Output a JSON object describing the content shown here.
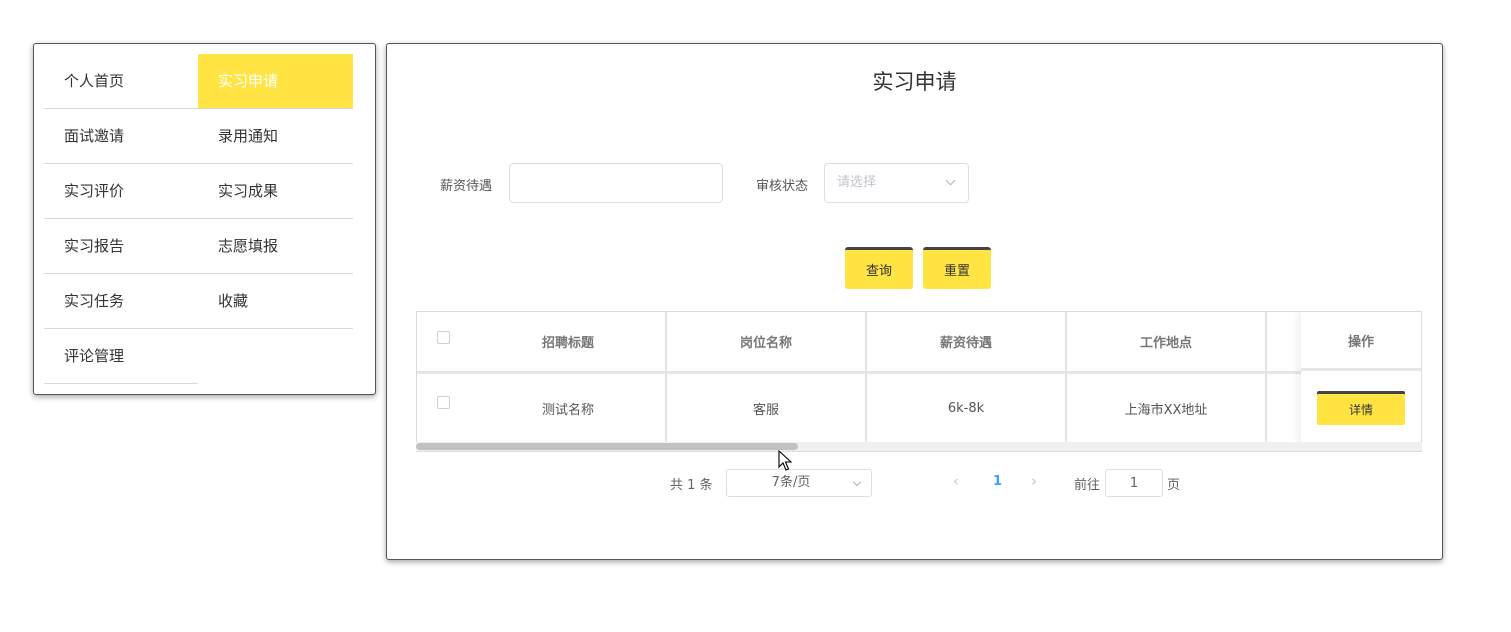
{
  "menu": {
    "items": [
      {
        "label": "个人首页",
        "active": false
      },
      {
        "label": "实习申请",
        "active": true
      },
      {
        "label": "面试邀请",
        "active": false
      },
      {
        "label": "录用通知",
        "active": false
      },
      {
        "label": "实习评价",
        "active": false
      },
      {
        "label": "实习成果",
        "active": false
      },
      {
        "label": "实习报告",
        "active": false
      },
      {
        "label": "志愿填报",
        "active": false
      },
      {
        "label": "实习任务",
        "active": false
      },
      {
        "label": "收藏",
        "active": false
      },
      {
        "label": "评论管理",
        "active": false
      }
    ]
  },
  "main": {
    "title": "实习申请",
    "search": {
      "salary_label": "薪资待遇",
      "salary_value": "",
      "status_label": "审核状态",
      "status_placeholder": "请选择"
    },
    "buttons": {
      "query": "查询",
      "reset": "重置"
    },
    "table": {
      "columns": [
        "招聘标题",
        "岗位名称",
        "薪资待遇",
        "工作地点",
        "操作"
      ],
      "rows": [
        {
          "title": "测试名称",
          "position": "客服",
          "salary": "6k-8k",
          "location": "上海市XX地址",
          "action": "详情"
        }
      ]
    },
    "pagination": {
      "total": "共 1 条",
      "page_size": "7条/页",
      "current_page": "1",
      "goto_label": "前往",
      "goto_value": "1",
      "page_suffix": "页"
    }
  },
  "colors": {
    "accent": "#ffe444",
    "link": "#409eff"
  }
}
